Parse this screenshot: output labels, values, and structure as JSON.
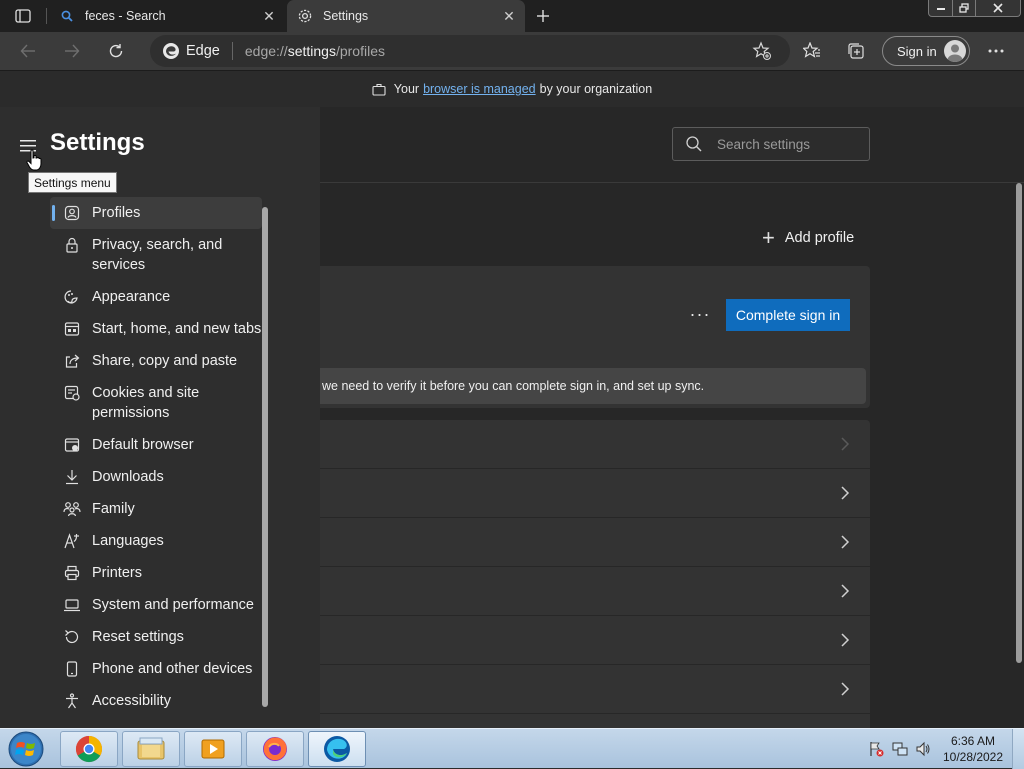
{
  "tabs": [
    {
      "title": "feces - Search",
      "active": false,
      "icon": "search-icon"
    },
    {
      "title": "Settings",
      "active": true,
      "icon": "gear-icon"
    }
  ],
  "toolbar": {
    "browser_label": "Edge",
    "url_scheme": "edge://",
    "url_host": "settings",
    "url_path": "/profiles",
    "signin_label": "Sign in"
  },
  "managed_bar": {
    "prefix": "Your",
    "link": "browser is managed",
    "suffix": "by your organization"
  },
  "sidebar": {
    "title": "Settings",
    "tooltip": "Settings menu",
    "items": [
      {
        "label": "Profiles",
        "icon": "profile-icon",
        "selected": true
      },
      {
        "label": "Privacy, search, and services",
        "icon": "lock-icon"
      },
      {
        "label": "Appearance",
        "icon": "appearance-icon"
      },
      {
        "label": "Start, home, and new tabs",
        "icon": "start-home-icon"
      },
      {
        "label": "Share, copy and paste",
        "icon": "share-icon"
      },
      {
        "label": "Cookies and site permissions",
        "icon": "cookies-icon"
      },
      {
        "label": "Default browser",
        "icon": "default-browser-icon"
      },
      {
        "label": "Downloads",
        "icon": "download-icon"
      },
      {
        "label": "Family",
        "icon": "family-icon"
      },
      {
        "label": "Languages",
        "icon": "languages-icon"
      },
      {
        "label": "Printers",
        "icon": "printer-icon"
      },
      {
        "label": "System and performance",
        "icon": "laptop-icon"
      },
      {
        "label": "Reset settings",
        "icon": "reset-icon"
      },
      {
        "label": "Phone and other devices",
        "icon": "phone-icon"
      },
      {
        "label": "Accessibility",
        "icon": "accessibility-icon"
      }
    ]
  },
  "search": {
    "placeholder": "Search settings"
  },
  "content": {
    "add_profile_label": "Add profile",
    "more_label": "···",
    "complete_signin_label": "Complete sign in",
    "verify_message": "we need to verify it before you can complete sign in, and set up sync."
  },
  "taskbar": {
    "apps": [
      "chrome",
      "file-explorer",
      "media-player",
      "firefox",
      "edge"
    ],
    "time": "6:36 AM",
    "date": "10/28/2022"
  },
  "colors": {
    "accent": "#0f6cbd",
    "link": "#73b2ef"
  }
}
